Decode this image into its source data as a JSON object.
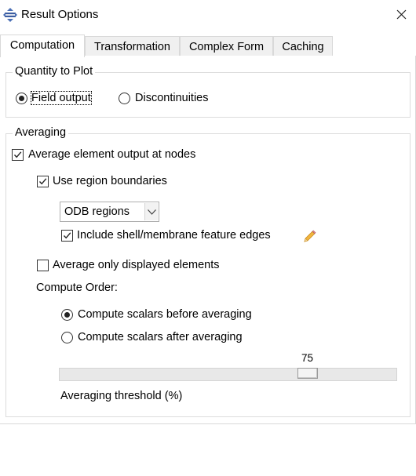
{
  "window": {
    "title": "Result Options",
    "icon": "abaqus-app-icon",
    "close_icon": "close-icon"
  },
  "tabs": [
    {
      "label": "Computation",
      "active": true
    },
    {
      "label": "Transformation",
      "active": false
    },
    {
      "label": "Complex Form",
      "active": false
    },
    {
      "label": "Caching",
      "active": false
    }
  ],
  "quantity": {
    "legend": "Quantity to Plot",
    "options": [
      {
        "label": "Field output",
        "checked": true
      },
      {
        "label": "Discontinuities",
        "checked": false
      }
    ]
  },
  "averaging": {
    "legend": "Averaging",
    "average_at_nodes": {
      "label": "Average element output at nodes",
      "checked": true
    },
    "use_region_boundaries": {
      "label": "Use region boundaries",
      "checked": true
    },
    "region_select": {
      "value": "ODB regions"
    },
    "include_edges": {
      "label": "Include shell/membrane feature edges",
      "checked": true,
      "icon": "pencil-icon"
    },
    "displayed_only": {
      "label": "Average only displayed elements",
      "checked": false
    },
    "compute_order": {
      "label": "Compute Order:",
      "options": [
        {
          "label": "Compute scalars before averaging",
          "checked": true
        },
        {
          "label": "Compute scalars after averaging",
          "checked": false
        }
      ]
    },
    "threshold": {
      "label": "Averaging threshold (%)",
      "value": 75,
      "min": 0,
      "max": 100
    }
  }
}
